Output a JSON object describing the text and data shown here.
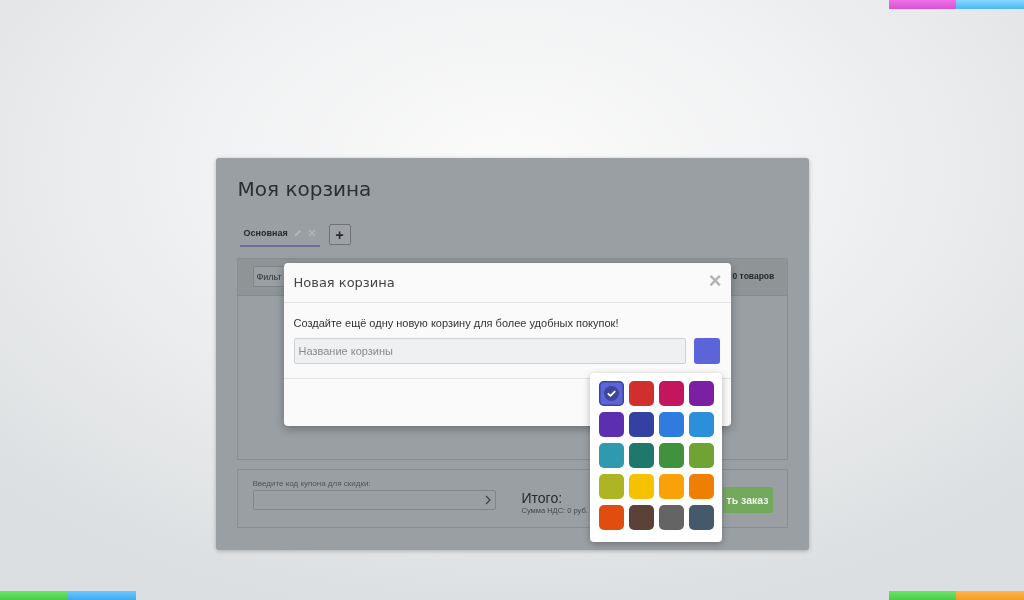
{
  "cart": {
    "title": "Моя корзина",
    "tabs": [
      {
        "label": "Основная",
        "selected": true
      }
    ],
    "add_tab_button": "+",
    "filter": {
      "placeholder": "Фильт"
    },
    "item_count": "0 товаров",
    "coupon": {
      "label": "Введите код купона для скидки:"
    },
    "total_label": "Итого:",
    "vat": "Сумма НДС: 0 руб.",
    "checkout_button": "ть заказ"
  },
  "dialog": {
    "title": "Новая корзина",
    "close": "×",
    "message": "Создайте ещё одну новую корзину для более удобных покупок!",
    "name_field": {
      "placeholder": "Название корзины"
    }
  },
  "color_palette": [
    {
      "color": "#5c64da",
      "selected": true
    },
    {
      "color": "#d12f2e",
      "selected": false
    },
    {
      "color": "#c2175c",
      "selected": false
    },
    {
      "color": "#7b1fa3",
      "selected": false
    },
    {
      "color": "#5c2fb0",
      "selected": false
    },
    {
      "color": "#3541a0",
      "selected": false
    },
    {
      "color": "#2f7cde",
      "selected": false
    },
    {
      "color": "#2b8fd9",
      "selected": false
    },
    {
      "color": "#2f9aad",
      "selected": false
    },
    {
      "color": "#1f786c",
      "selected": false
    },
    {
      "color": "#41923f",
      "selected": false
    },
    {
      "color": "#6fa333",
      "selected": false
    },
    {
      "color": "#adb524",
      "selected": false
    },
    {
      "color": "#f6c100",
      "selected": false
    },
    {
      "color": "#f8a109",
      "selected": false
    },
    {
      "color": "#ef7e04",
      "selected": false
    },
    {
      "color": "#e04d0e",
      "selected": false
    },
    {
      "color": "#5b4137",
      "selected": false
    },
    {
      "color": "#646464",
      "selected": false
    },
    {
      "color": "#46596a",
      "selected": false
    }
  ]
}
